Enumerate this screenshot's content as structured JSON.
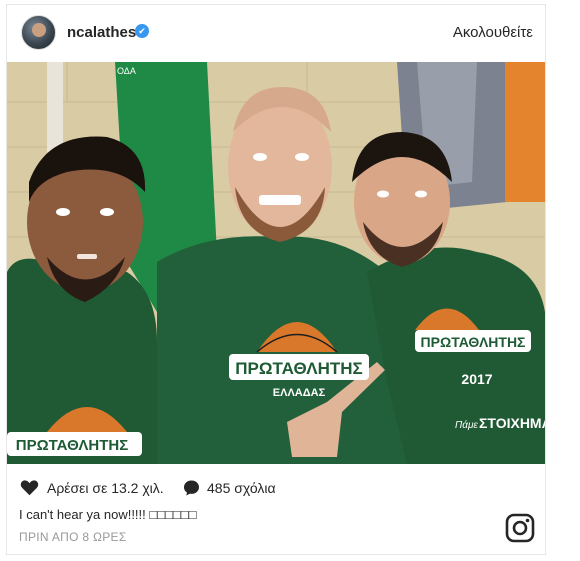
{
  "post": {
    "username": "ncalathes",
    "verified_mark": "✔",
    "follow_label": "Ακολουθείτε",
    "likes_text": "Αρέσει σε 13.2 χιλ.",
    "comments_text": "485 σχόλια",
    "caption": "I can't hear ya now!!!!! □□□□□□",
    "timestamp": "ΠΡΙΝ ΑΠΟ 8 ΩΡΕΣ"
  },
  "photo": {
    "shirt_text_main": "ΠΡΩΤΑΘΛΗΤΗΣ",
    "shirt_text_sub": "ΕΛΛΑΔΑΣ",
    "shirt_text_year": "2017",
    "shirt_text_slogan": "ΣΤΟΙΧΗΜΑ",
    "shirt_text_small": "Πάμε",
    "jersey_tag": "ΟΔΑ"
  },
  "icons": {
    "avatar": "profile-avatar",
    "verified": "verified-badge-icon",
    "heart": "heart-icon",
    "comment": "speech-bubble-icon",
    "brand": "instagram-logo-icon"
  },
  "colors": {
    "text": "#262626",
    "muted": "#999999",
    "verified_blue": "#3897f0",
    "shirt_green": "#1e5b35",
    "ball_orange": "#d9782a"
  }
}
